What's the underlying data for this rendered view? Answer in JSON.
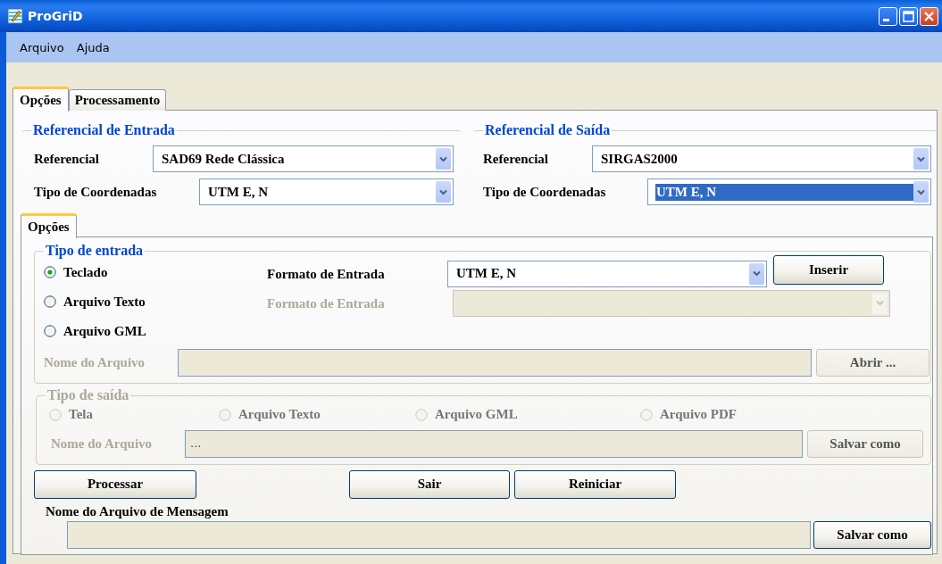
{
  "window": {
    "title": "ProGriD"
  },
  "menu": [
    {
      "label": "Arquivo"
    },
    {
      "label": "Ajuda"
    }
  ],
  "tabs": [
    {
      "label": "Opções",
      "selected": true
    },
    {
      "label": "Processamento",
      "selected": false
    }
  ],
  "input_reference": {
    "title": "Referencial de Entrada",
    "referencial": {
      "label": "Referencial",
      "value": "SAD69 Rede Clássica",
      "selected": false
    },
    "coordinate_type": {
      "label": "Tipo de Coordenadas",
      "value": "UTM E, N",
      "selected": false
    }
  },
  "output_reference": {
    "title": "Referencial de Saída",
    "referencial": {
      "label": "Referencial",
      "value": "SIRGAS2000",
      "selected": false
    },
    "coordinate_type": {
      "label": "Tipo de Coordenadas",
      "value": "UTM E, N",
      "selected": true
    }
  },
  "inner_tabs": [
    {
      "label": "Opções",
      "selected": true
    }
  ],
  "input_type": {
    "title": "Tipo de entrada",
    "options": [
      {
        "label": "Teclado",
        "selected": true
      },
      {
        "label": "Arquivo Texto",
        "selected": false
      },
      {
        "label": "Arquivo GML",
        "selected": false
      }
    ],
    "formats": [
      {
        "label": "Formato de Entrada",
        "value": "UTM E, N",
        "disabled": false
      },
      {
        "label": "Formato de Entrada",
        "disabled": true
      }
    ],
    "insert_button": "Inserir",
    "file": {
      "label": "Nome do Arquivo",
      "disabled": true,
      "button": "Abrir ..."
    }
  },
  "output_type": {
    "title": "Tipo de saída",
    "disabled": true,
    "options": [
      {
        "label": "Tela",
        "selected": false
      },
      {
        "label": "Arquivo Texto",
        "selected": false
      },
      {
        "label": "Arquivo GML",
        "selected": false
      },
      {
        "label": "Arquivo PDF",
        "selected": false
      }
    ],
    "file": {
      "label": "Nome do Arquivo",
      "value": "...",
      "button": "Salvar como"
    }
  },
  "actions": [
    {
      "label": "Processar"
    },
    {
      "label": "Sair"
    },
    {
      "label": "Reiniciar"
    }
  ],
  "message_file": {
    "label": "Nome do Arquivo de Mensagem",
    "disabled": true,
    "button": "Salvar como"
  }
}
